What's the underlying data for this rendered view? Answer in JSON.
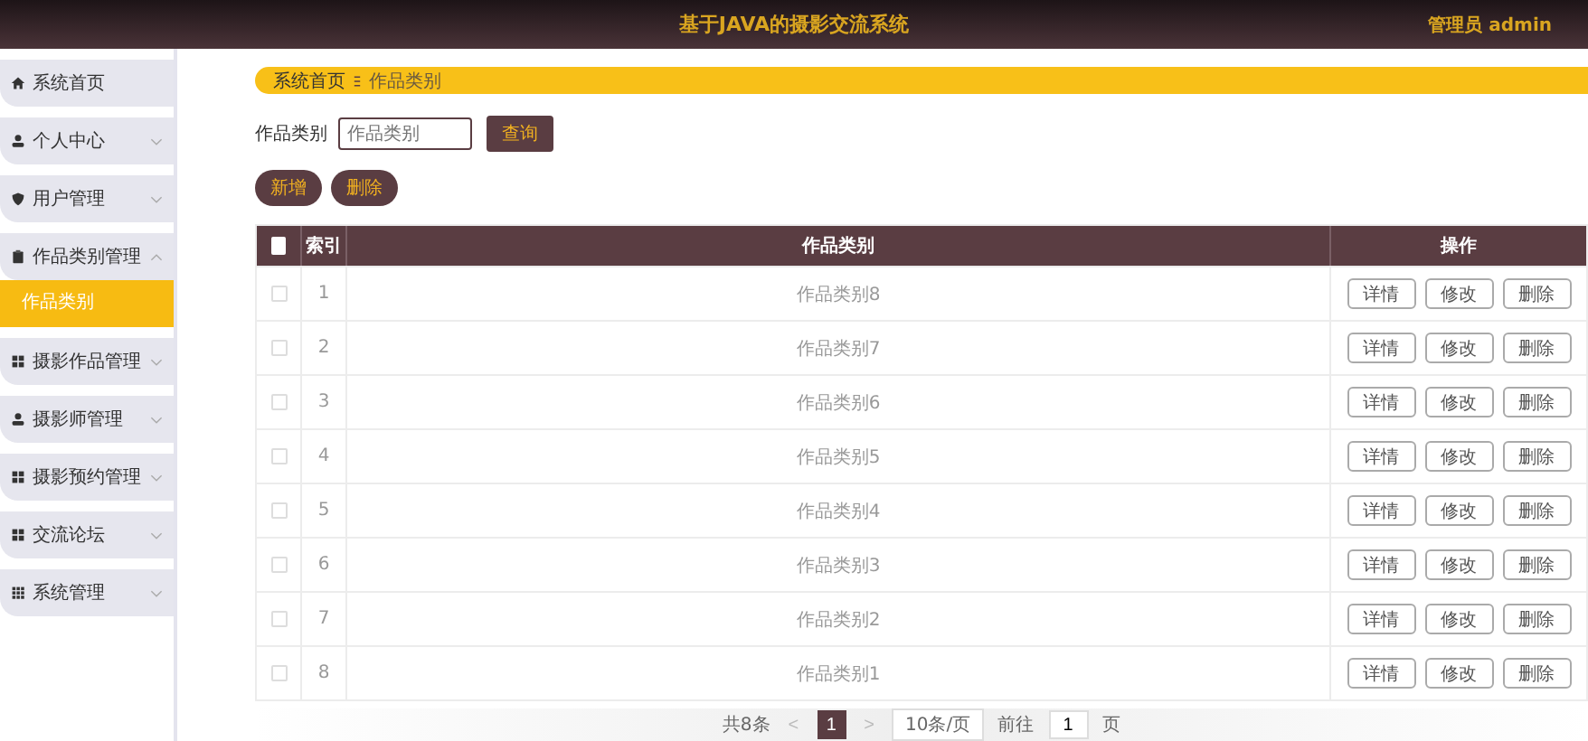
{
  "header": {
    "title": "基于JAVA的摄影交流系统",
    "user": "管理员 admin"
  },
  "sidebar": {
    "items": [
      {
        "label": "系统首页"
      },
      {
        "label": "个人中心",
        "expanded": false
      },
      {
        "label": "用户管理",
        "expanded": false
      },
      {
        "label": "作品类别管理",
        "expanded": true,
        "children": [
          {
            "label": "作品类别",
            "selected": true
          }
        ]
      },
      {
        "label": "摄影作品管理",
        "expanded": false
      },
      {
        "label": "摄影师管理",
        "expanded": false
      },
      {
        "label": "摄影预约管理",
        "expanded": false
      },
      {
        "label": "交流论坛",
        "expanded": false
      },
      {
        "label": "系统管理",
        "expanded": false
      }
    ]
  },
  "breadcrumb": [
    "系统首页",
    "作品类别"
  ],
  "search": {
    "label": "作品类别",
    "placeholder": "作品类别",
    "button": "查询"
  },
  "actions": [
    "新增",
    "删除"
  ],
  "table": {
    "all_checked": false,
    "columns": [
      "索引",
      "作品类别",
      "操作"
    ],
    "rows": [
      {
        "index": "1",
        "name": "作品类别8",
        "checked": false,
        "buttons": [
          "详情",
          "修改",
          "删除"
        ]
      },
      {
        "index": "2",
        "name": "作品类别7",
        "checked": false,
        "buttons": [
          "详情",
          "修改",
          "删除"
        ]
      },
      {
        "index": "3",
        "name": "作品类别6",
        "checked": false,
        "buttons": [
          "详情",
          "修改",
          "删除"
        ]
      },
      {
        "index": "4",
        "name": "作品类别5",
        "checked": false,
        "buttons": [
          "详情",
          "修改",
          "删除"
        ]
      },
      {
        "index": "5",
        "name": "作品类别4",
        "checked": false,
        "buttons": [
          "详情",
          "修改",
          "删除"
        ]
      },
      {
        "index": "6",
        "name": "作品类别3",
        "checked": false,
        "buttons": [
          "详情",
          "修改",
          "删除"
        ]
      },
      {
        "index": "7",
        "name": "作品类别2",
        "checked": false,
        "buttons": [
          "详情",
          "修改",
          "删除"
        ]
      },
      {
        "index": "8",
        "name": "作品类别1",
        "checked": false,
        "buttons": [
          "详情",
          "修改",
          "删除"
        ]
      }
    ]
  },
  "pagination": {
    "total": "共8条",
    "prev": "<",
    "pages": [
      {
        "label": "1",
        "selected": true
      }
    ],
    "next": ">",
    "page_size": "10条/页",
    "goto_label": "前往",
    "goto_value": "1",
    "goto_unit": "页"
  }
}
